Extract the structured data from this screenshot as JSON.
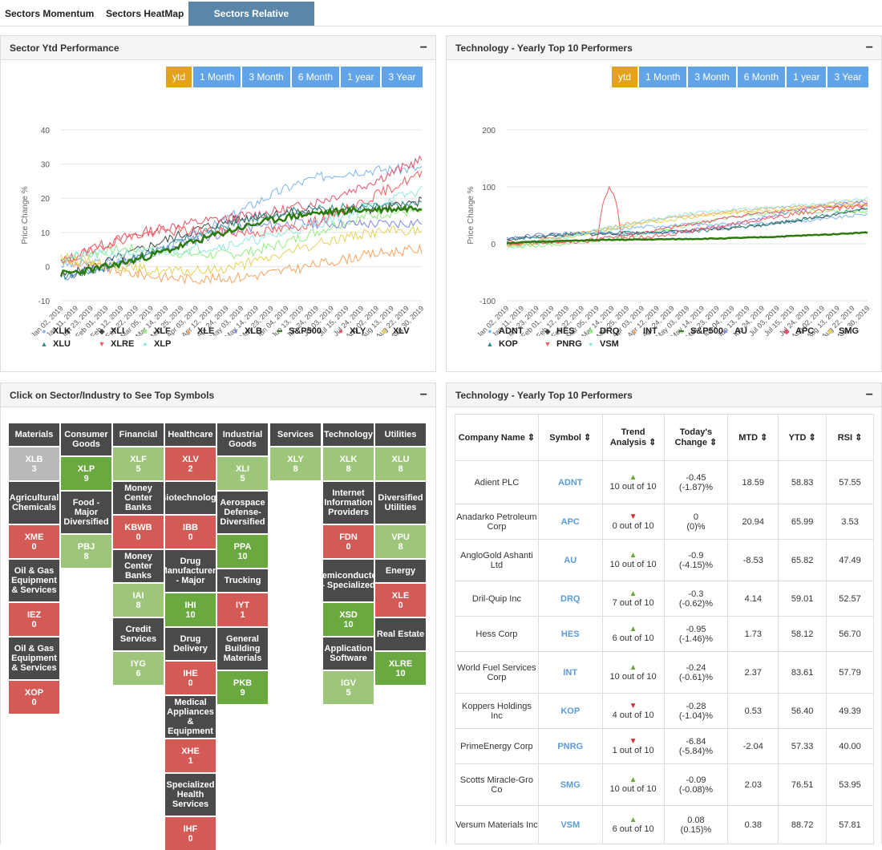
{
  "tabs": [
    "Sectors Momentum",
    "Sectors HeatMap",
    "Sectors Relative Strength"
  ],
  "colors": {
    "accent": "#62a4e8",
    "active_range": "#e3a21a",
    "tab_active": "#5a87a9",
    "positive": "#6aa840",
    "negative": "#d45a55"
  },
  "panel1": {
    "title": "Sector Ytd Performance",
    "min": "−",
    "ranges": [
      "ytd",
      "1 Month",
      "3 Month",
      "6 Month",
      "1 year",
      "3 Year"
    ],
    "ylabel": "Price Change %",
    "yticks": [
      "40",
      "30",
      "20",
      "10",
      "0",
      "-10"
    ],
    "xticks": [
      "Jan 02, 2019",
      "Jan 11, 2019",
      "Jan 23, 2019",
      "Feb 01, 2019",
      "Feb 12, 2019",
      "Feb 22, 2019",
      "Mar 05, 2019",
      "Mar 14, 2019",
      "Mar 25, 2019",
      "Apr 03, 2019",
      "Apr 12, 2019",
      "Apr 24, 2019",
      "May 03, 2019",
      "May 14, 2019",
      "May 23, 2019",
      "Jun 04, 2019",
      "Jun 13, 2019",
      "Jun 24, 2019",
      "Jul 03, 2019",
      "Jul 15, 2019",
      "Jul 24, 2019",
      "Aug 02, 2019",
      "Aug 13, 2019",
      "Aug 22, 2019",
      "Aug 30, 2019"
    ],
    "legend": [
      "XLK",
      "XLI",
      "XLF",
      "XLE",
      "XLB",
      "S&P500",
      "XLY",
      "XLV",
      "XLU",
      "XLRE",
      "XLP"
    ]
  },
  "panel2": {
    "title": "Technology - Yearly Top 10 Performers",
    "min": "−",
    "ranges": [
      "ytd",
      "1 Month",
      "3 Month",
      "6 Month",
      "1 year",
      "3 Year"
    ],
    "ylabel": "Price Change %",
    "yticks": [
      "200",
      "100",
      "0",
      "-100"
    ],
    "xticks": [
      "Jan 02, 2019",
      "Jan 11, 2019",
      "Jan 23, 2019",
      "Feb 01, 2019",
      "Feb 12, 2019",
      "Feb 22, 2019",
      "Mar 05, 2019",
      "Mar 14, 2019",
      "Mar 25, 2019",
      "Apr 03, 2019",
      "Apr 12, 2019",
      "Apr 24, 2019",
      "May 03, 2019",
      "May 14, 2019",
      "May 23, 2019",
      "Jun 04, 2019",
      "Jun 13, 2019",
      "Jun 24, 2019",
      "Jul 03, 2019",
      "Jul 15, 2019",
      "Jul 24, 2019",
      "Aug 02, 2019",
      "Aug 13, 2019",
      "Aug 22, 2019",
      "Aug 30, 2019"
    ],
    "legend": [
      "ADNT",
      "HES",
      "DRQ",
      "INT",
      "S&P500",
      "AU",
      "APC",
      "SMG",
      "KOP",
      "PNRG",
      "VSM"
    ]
  },
  "panel3": {
    "title": "Click on Sector/Industry to See Top Symbols",
    "min": "−"
  },
  "panel4": {
    "title": "Technology - Yearly Top 10 Performers",
    "min": "−",
    "headers": [
      "Company Name ⇕",
      "Symbol ⇕",
      "Trend Analysis ⇕",
      "Today's Change ⇕",
      "MTD ⇕",
      "YTD ⇕",
      "RSI ⇕"
    ],
    "rows": [
      {
        "company": "Adient PLC",
        "symbol": "ADNT",
        "trend": "up",
        "trend_text": "10 out of 10",
        "change": "-0.45",
        "pct": "(-1.87)%",
        "mtd": "18.59",
        "ytd": "58.83",
        "rsi": "57.55"
      },
      {
        "company": "Anadarko Petroleum Corp",
        "symbol": "APC",
        "trend": "down",
        "trend_text": "0 out of 10",
        "change": "0",
        "pct": "(0)%",
        "mtd": "20.94",
        "ytd": "65.99",
        "rsi": "3.53"
      },
      {
        "company": "AngloGold Ashanti Ltd",
        "symbol": "AU",
        "trend": "up",
        "trend_text": "10 out of 10",
        "change": "-0.9",
        "pct": "(-4.15)%",
        "mtd": "-8.53",
        "ytd": "65.82",
        "rsi": "47.49"
      },
      {
        "company": "Dril-Quip Inc",
        "symbol": "DRQ",
        "trend": "up",
        "trend_text": "7 out of 10",
        "change": "-0.3",
        "pct": "(-0.62)%",
        "mtd": "4.14",
        "ytd": "59.01",
        "rsi": "52.57"
      },
      {
        "company": "Hess Corp",
        "symbol": "HES",
        "trend": "up",
        "trend_text": "6 out of 10",
        "change": "-0.95",
        "pct": "(-1.46)%",
        "mtd": "1.73",
        "ytd": "58.12",
        "rsi": "56.70"
      },
      {
        "company": "World Fuel Services Corp",
        "symbol": "INT",
        "trend": "up",
        "trend_text": "10 out of 10",
        "change": "-0.24",
        "pct": "(-0.61)%",
        "mtd": "2.37",
        "ytd": "83.61",
        "rsi": "57.79"
      },
      {
        "company": "Koppers Holdings Inc",
        "symbol": "KOP",
        "trend": "down",
        "trend_text": "4 out of 10",
        "change": "-0.28",
        "pct": "(-1.04)%",
        "mtd": "0.53",
        "ytd": "56.40",
        "rsi": "49.39"
      },
      {
        "company": "PrimeEnergy Corp",
        "symbol": "PNRG",
        "trend": "down",
        "trend_text": "1 out of 10",
        "change": "-6.84",
        "pct": "(-5.84)%",
        "mtd": "-2.04",
        "ytd": "57.33",
        "rsi": "40.00"
      },
      {
        "company": "Scotts Miracle-Gro Co",
        "symbol": "SMG",
        "trend": "up",
        "trend_text": "10 out of 10",
        "change": "-0.09",
        "pct": "(-0.08)%",
        "mtd": "2.03",
        "ytd": "76.51",
        "rsi": "53.95"
      },
      {
        "company": "Versum Materials Inc",
        "symbol": "VSM",
        "trend": "up",
        "trend_text": "6 out of 10",
        "change": "0.08",
        "pct": "(0.15)%",
        "mtd": "0.38",
        "ytd": "88.72",
        "rsi": "57.81"
      }
    ]
  },
  "heatmap": {
    "c0": [
      {
        "l": "Materials",
        "t": "dark"
      },
      {
        "l": "XLB",
        "n": "3",
        "t": "gray"
      },
      {
        "l": "Agricultural Chemicals",
        "t": "dark"
      },
      {
        "l": "XME",
        "n": "0",
        "t": "red"
      },
      {
        "l": "Oil & Gas Equipment & Services",
        "t": "dark"
      },
      {
        "l": "IEZ",
        "n": "0",
        "t": "red"
      },
      {
        "l": "Oil & Gas Equipment & Services",
        "t": "dark"
      },
      {
        "l": "XOP",
        "n": "0",
        "t": "red"
      }
    ],
    "c1": [
      {
        "l": "Consumer Goods",
        "t": "dark"
      },
      {
        "l": "XLP",
        "n": "9",
        "t": "g"
      },
      {
        "l": "Food - Major Diversified",
        "t": "dark"
      },
      {
        "l": "PBJ",
        "n": "8",
        "t": "lg"
      }
    ],
    "c2": [
      {
        "l": "Financial",
        "t": "dark"
      },
      {
        "l": "XLF",
        "n": "5",
        "t": "lg"
      },
      {
        "l": "Money Center Banks",
        "t": "dark"
      },
      {
        "l": "KBWB",
        "n": "0",
        "t": "red"
      },
      {
        "l": "Money Center Banks",
        "t": "dark"
      },
      {
        "l": "IAI",
        "n": "8",
        "t": "lg"
      },
      {
        "l": "Credit Services",
        "t": "dark"
      },
      {
        "l": "IYG",
        "n": "6",
        "t": "lg"
      }
    ],
    "c3": [
      {
        "l": "Healthcare",
        "t": "dark"
      },
      {
        "l": "XLV",
        "n": "2",
        "t": "red"
      },
      {
        "l": "Biotechnology",
        "t": "dark"
      },
      {
        "l": "IBB",
        "n": "0",
        "t": "red"
      },
      {
        "l": "Drug Manufacturers - Major",
        "t": "dark"
      },
      {
        "l": "IHI",
        "n": "10",
        "t": "g"
      },
      {
        "l": "Drug Delivery",
        "t": "dark"
      },
      {
        "l": "IHE",
        "n": "0",
        "t": "red"
      },
      {
        "l": "Medical Appliances & Equipment",
        "t": "dark"
      },
      {
        "l": "XHE",
        "n": "1",
        "t": "red"
      },
      {
        "l": "Specialized Health Services",
        "t": "dark"
      },
      {
        "l": "IHF",
        "n": "0",
        "t": "red"
      }
    ],
    "c4": [
      {
        "l": "Industrial Goods",
        "t": "dark"
      },
      {
        "l": "XLI",
        "n": "5",
        "t": "lg"
      },
      {
        "l": "Aerospace Defense-Diversified",
        "t": "dark"
      },
      {
        "l": "PPA",
        "n": "10",
        "t": "g"
      },
      {
        "l": "Trucking",
        "t": "dark"
      },
      {
        "l": "IYT",
        "n": "1",
        "t": "red"
      },
      {
        "l": "General Building Materials",
        "t": "dark"
      },
      {
        "l": "PKB",
        "n": "9",
        "t": "g"
      }
    ],
    "c5": [
      {
        "l": "Services",
        "t": "dark"
      },
      {
        "l": "XLY",
        "n": "8",
        "t": "lg"
      }
    ],
    "c6": [
      {
        "l": "Technology",
        "t": "dark"
      },
      {
        "l": "XLK",
        "n": "8",
        "t": "lg"
      },
      {
        "l": "Internet Information Providers",
        "t": "dark"
      },
      {
        "l": "FDN",
        "n": "0",
        "t": "red"
      },
      {
        "l": "Semiconductor - Specialized",
        "t": "dark"
      },
      {
        "l": "XSD",
        "n": "10",
        "t": "g"
      },
      {
        "l": "Application Software",
        "t": "dark"
      },
      {
        "l": "IGV",
        "n": "5",
        "t": "lg"
      }
    ],
    "c7": [
      {
        "l": "Utilities",
        "t": "dark"
      },
      {
        "l": "XLU",
        "n": "8",
        "t": "lg"
      },
      {
        "l": "Diversified Utilities",
        "t": "dark"
      },
      {
        "l": "VPU",
        "n": "8",
        "t": "lg"
      },
      {
        "l": "Energy",
        "t": "dark"
      },
      {
        "l": "XLE",
        "n": "0",
        "t": "red"
      },
      {
        "l": "Real Estate",
        "t": "dark"
      },
      {
        "l": "XLRE",
        "n": "10",
        "t": "g"
      }
    ]
  }
}
